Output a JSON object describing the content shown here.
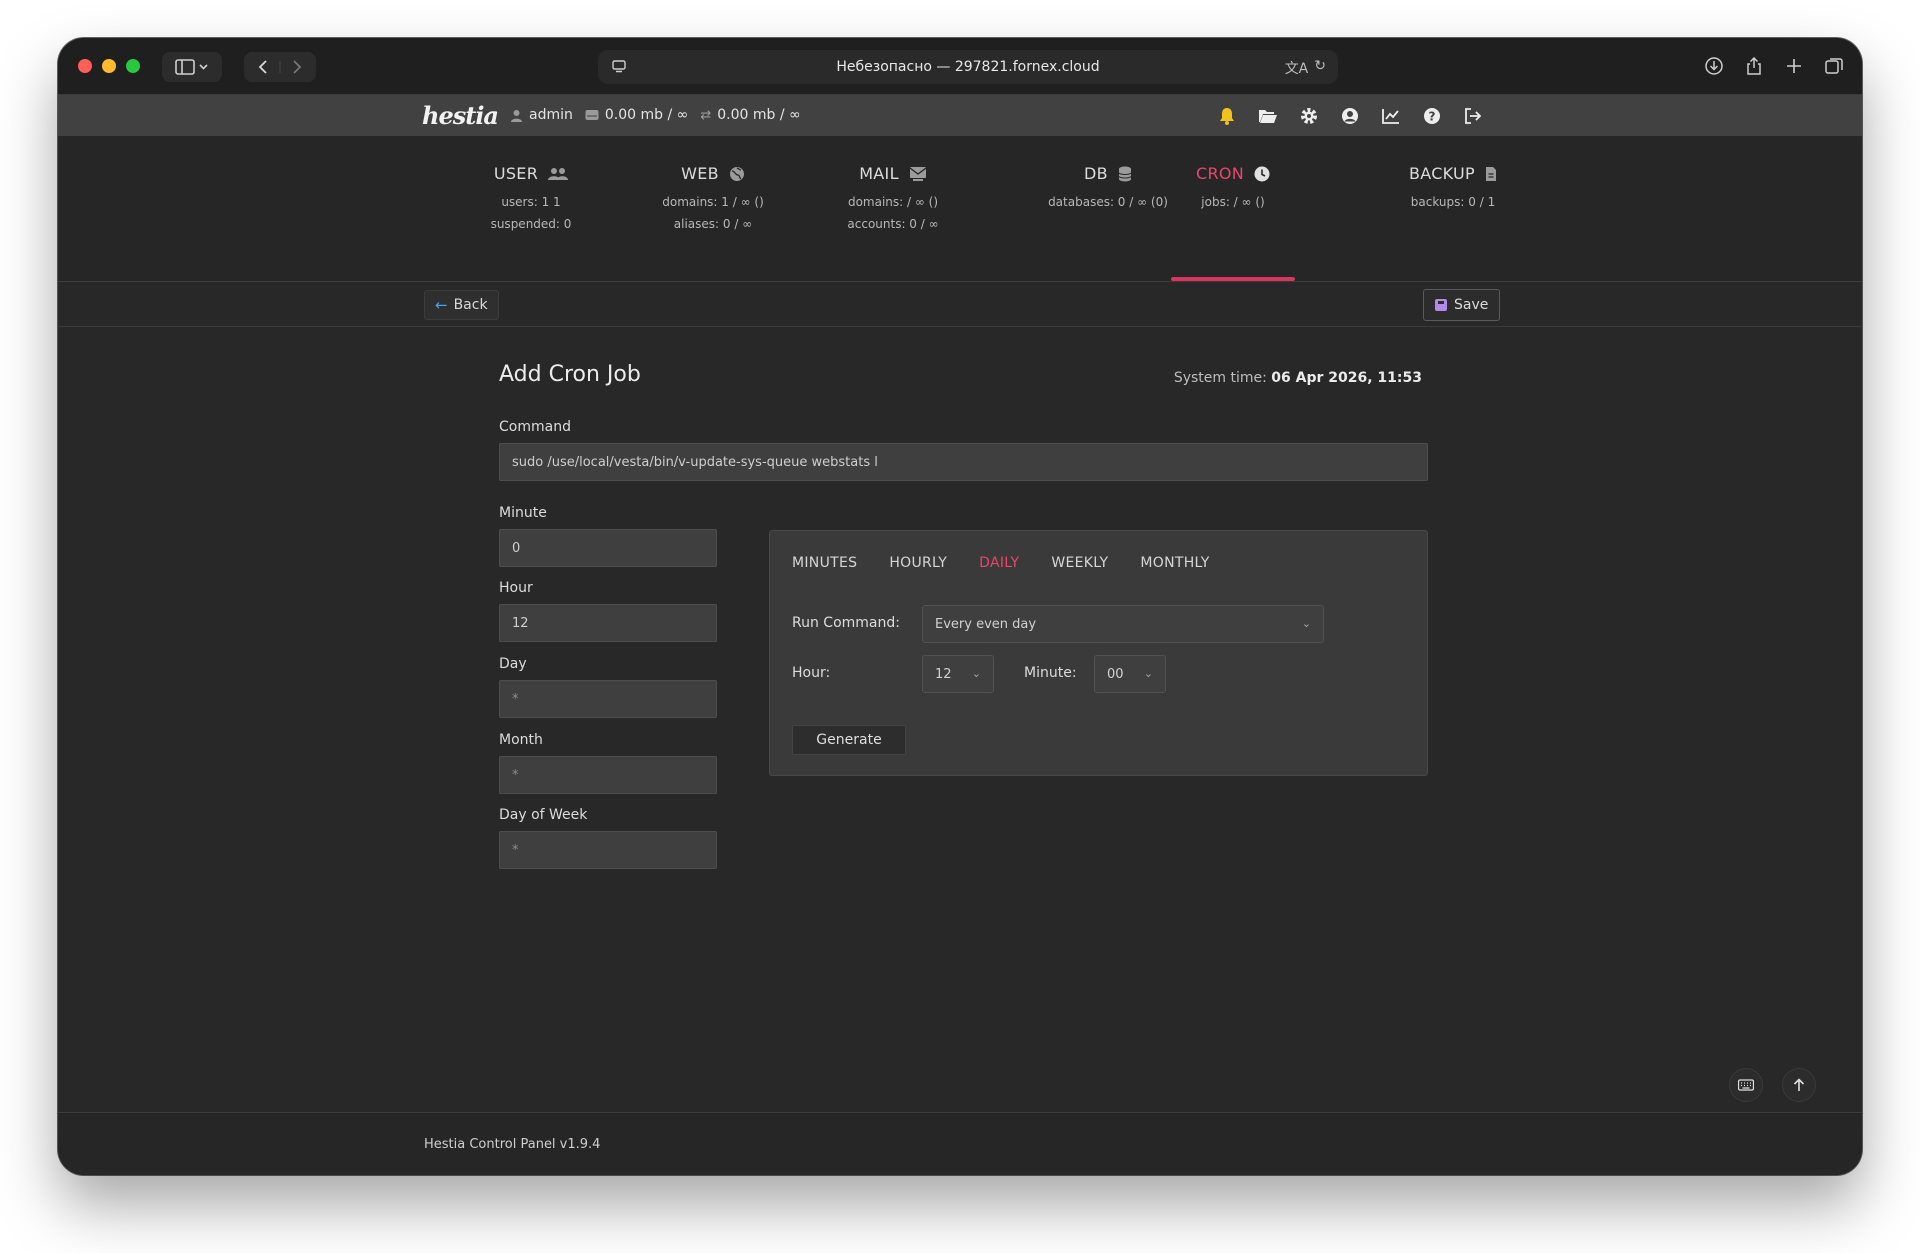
{
  "browser": {
    "address": "Небезопасно — 297821.fornex.cloud"
  },
  "topbar": {
    "logo": "hestia",
    "user": "admin",
    "disk": "0.00 mb / ∞",
    "bandwidth": "0.00 mb / ∞"
  },
  "tabs": [
    {
      "title": "USER",
      "line1": "users: 1 1",
      "line2": "suspended: 0",
      "icon": "users-icon"
    },
    {
      "title": "WEB",
      "line1": "domains: 1 / ∞ ()",
      "line2": "aliases: 0 / ∞",
      "icon": "globe-icon"
    },
    {
      "title": "MAIL",
      "line1": "domains: / ∞ ()",
      "line2": "accounts: 0 / ∞",
      "icon": "mail-icon"
    },
    {
      "title": "DB",
      "line1": "databases: 0 / ∞ (0)",
      "line2": "",
      "icon": "database-icon"
    },
    {
      "title": "CRON",
      "line1": "jobs: / ∞ ()",
      "line2": "",
      "icon": "clock-icon",
      "active": true
    },
    {
      "title": "BACKUP",
      "line1": "backups: 0 / 1",
      "line2": "",
      "icon": "file-icon"
    }
  ],
  "actions": {
    "back_label": "Back",
    "save_label": "Save"
  },
  "form": {
    "title": "Add Cron Job",
    "system_time_label": "System time:",
    "system_time_value": "06 Apr 2026, 11:53",
    "command_label": "Command",
    "command_value": "sudo /use/local/vesta/bin/v-update-sys-queue webstats l",
    "minute_label": "Minute",
    "minute_value": "0",
    "hour_label": "Hour",
    "hour_value": "12",
    "day_label": "Day",
    "day_value": "*",
    "month_label": "Month",
    "month_value": "*",
    "dow_label": "Day of Week",
    "dow_value": "*"
  },
  "generator": {
    "tabs": [
      "MINUTES",
      "HOURLY",
      "DAILY",
      "WEEKLY",
      "MONTHLY"
    ],
    "active_tab": "DAILY",
    "run_label": "Run Command:",
    "run_value": "Every even day",
    "hour_label": "Hour:",
    "hour_value": "12",
    "minute_label": "Minute:",
    "minute_value": "00",
    "generate_label": "Generate"
  },
  "footer": {
    "text": "Hestia Control Panel v1.9.4"
  },
  "colors": {
    "accent": "#e8466c",
    "background": "#282828",
    "topbar": "#414141"
  }
}
